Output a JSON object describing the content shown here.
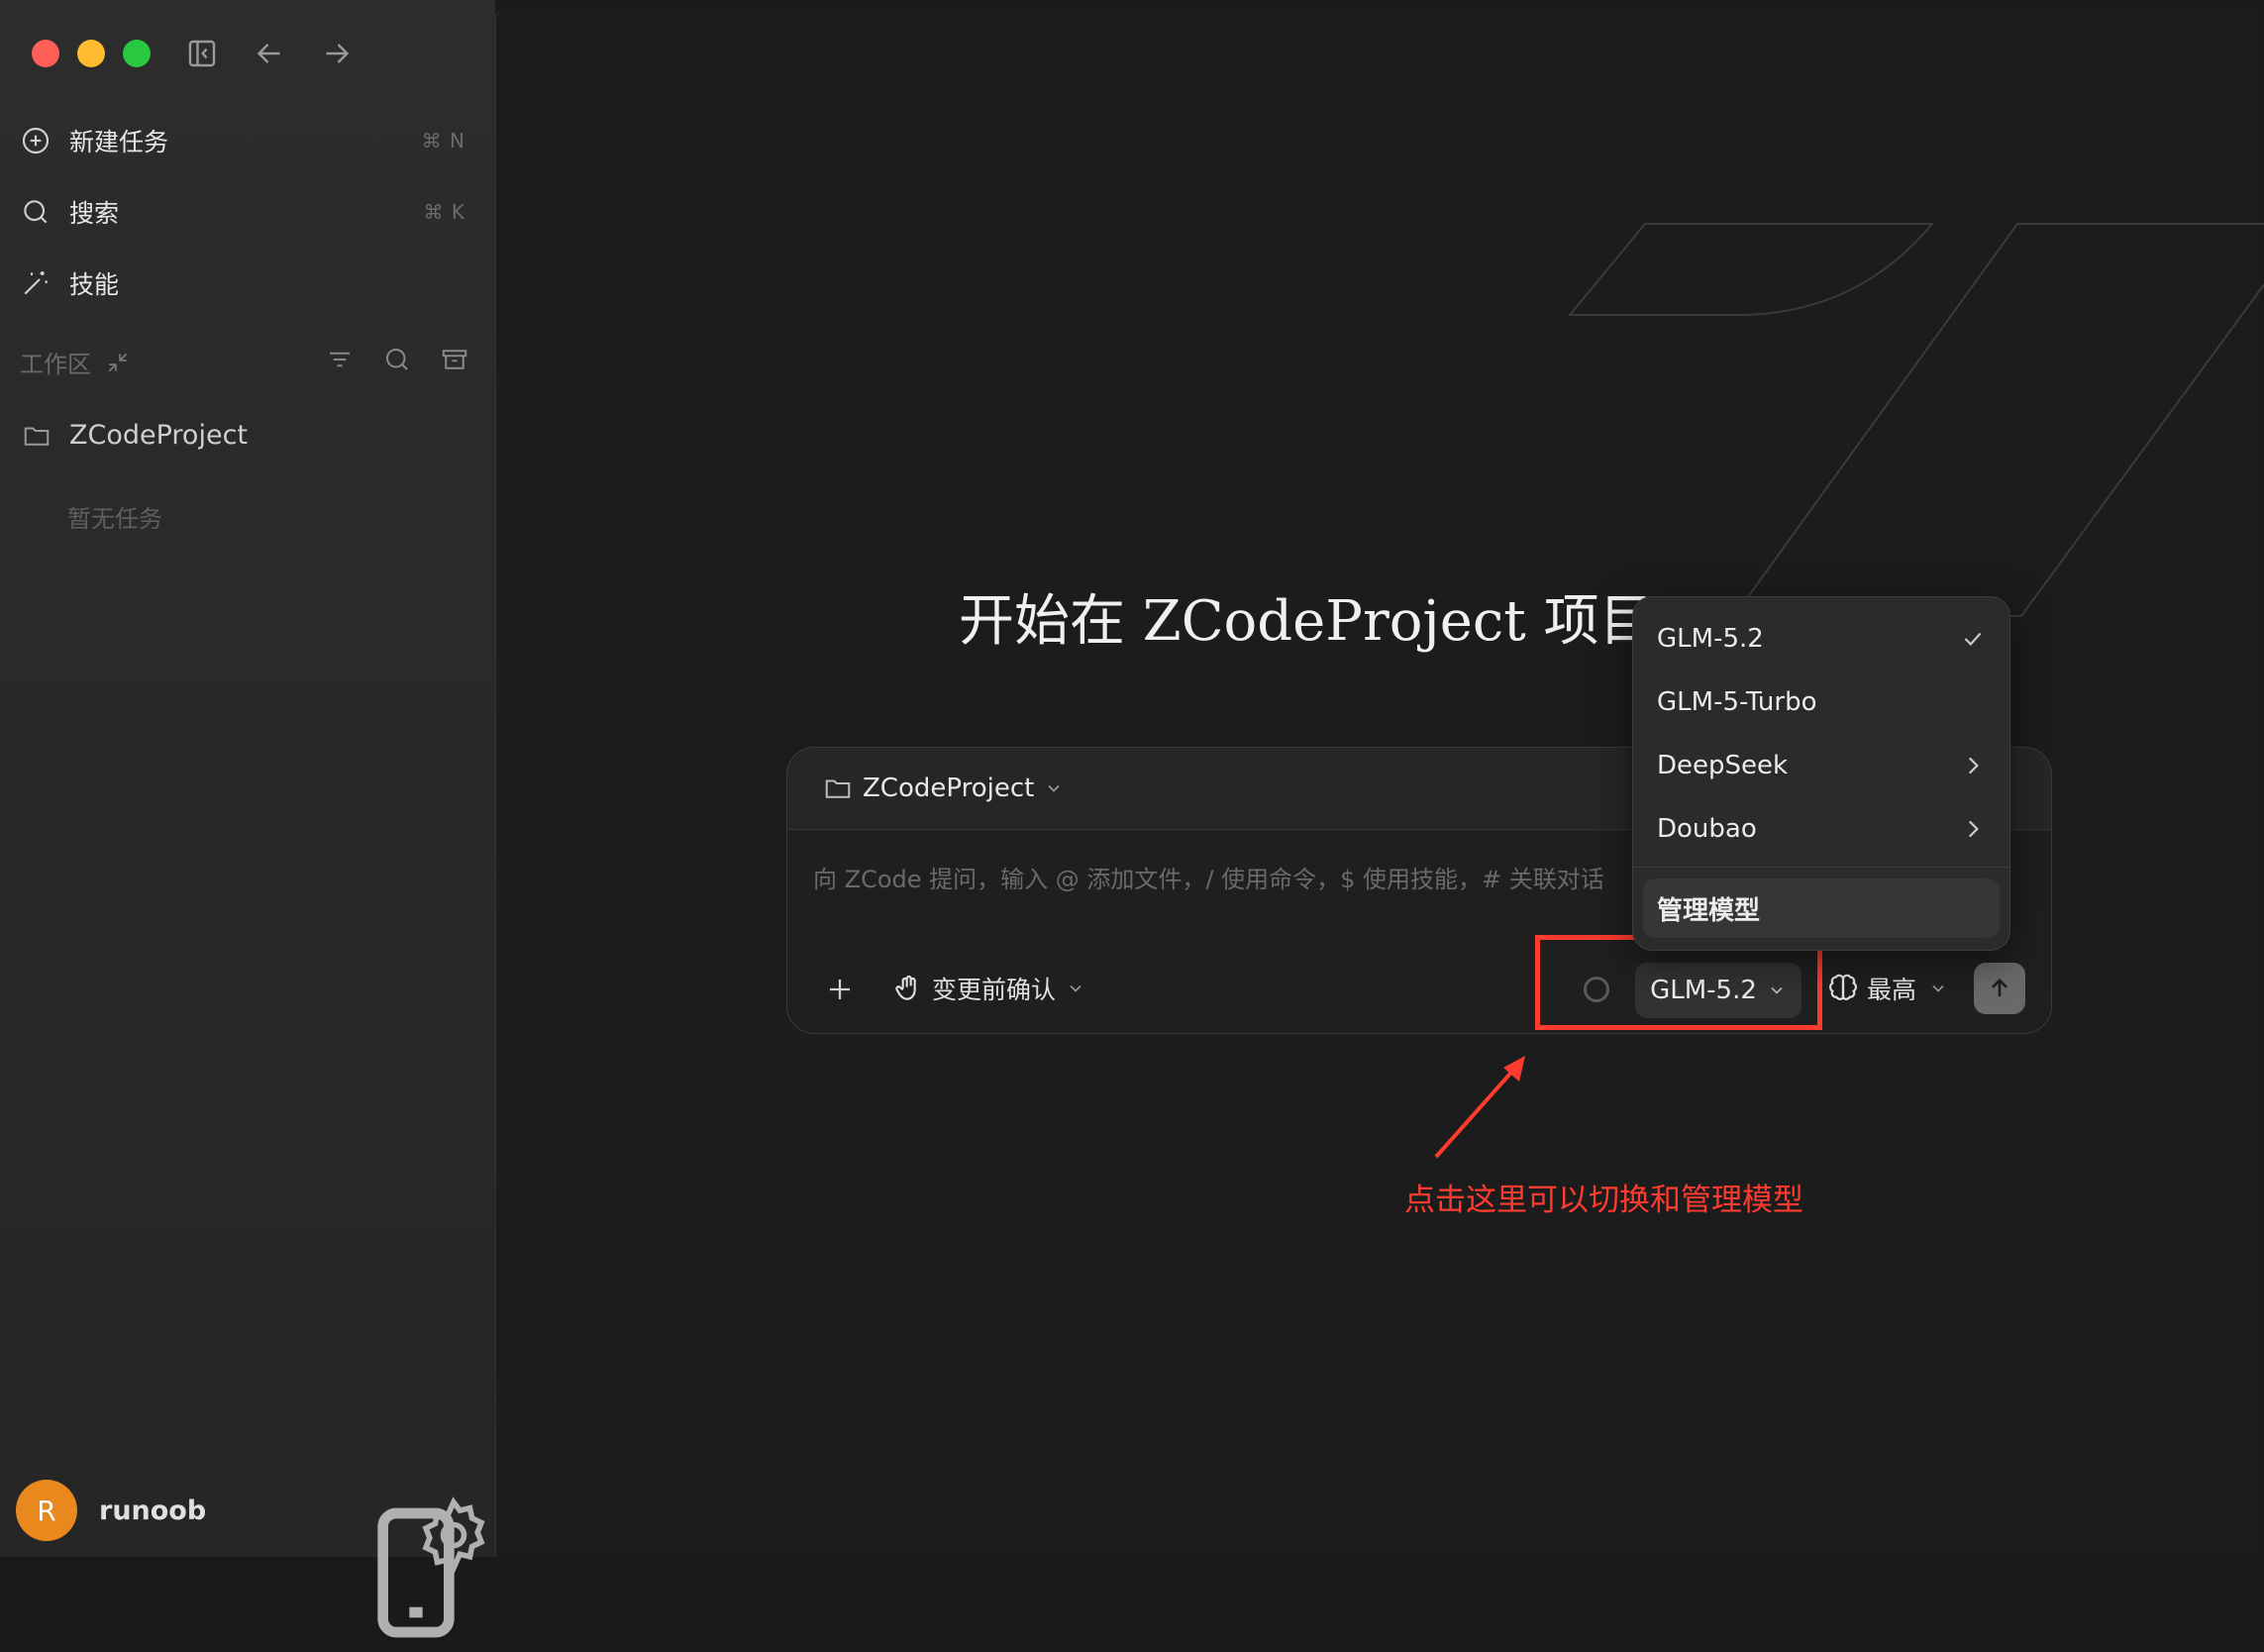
{
  "sidebar": {
    "nav": [
      {
        "label": "新建任务",
        "shortcut": "⌘ N",
        "icon": "plus-circle-icon"
      },
      {
        "label": "搜索",
        "shortcut": "⌘ K",
        "icon": "search-icon"
      },
      {
        "label": "技能",
        "shortcut": "",
        "icon": "magic-wand-icon"
      }
    ],
    "workspace_label": "工作区",
    "project_name": "ZCodeProject",
    "empty_text": "暂无任务",
    "user": {
      "initial": "R",
      "name": "runoob"
    }
  },
  "main": {
    "headline": "开始在 ZCodeProject 项目",
    "composer": {
      "project": "ZCodeProject",
      "placeholder": "向 ZCode 提问，输入 @ 添加文件，/ 使用命令，$ 使用技能，# 关联对话",
      "confirm_label": "变更前确认",
      "model_label": "GLM-5.2",
      "effort_label": "最高"
    },
    "model_menu": {
      "items": [
        {
          "label": "GLM-5.2",
          "mark": "check-icon"
        },
        {
          "label": "GLM-5-Turbo",
          "mark": ""
        },
        {
          "label": "DeepSeek",
          "mark": "chevron-right-icon"
        },
        {
          "label": "Doubao",
          "mark": "chevron-right-icon"
        }
      ],
      "manage_label": "管理模型"
    },
    "annotation": "点击这里可以切换和管理模型"
  },
  "colors": {
    "highlight": "#ff3b2f",
    "avatar": "#e9891d",
    "background": "#1c1c1c"
  }
}
